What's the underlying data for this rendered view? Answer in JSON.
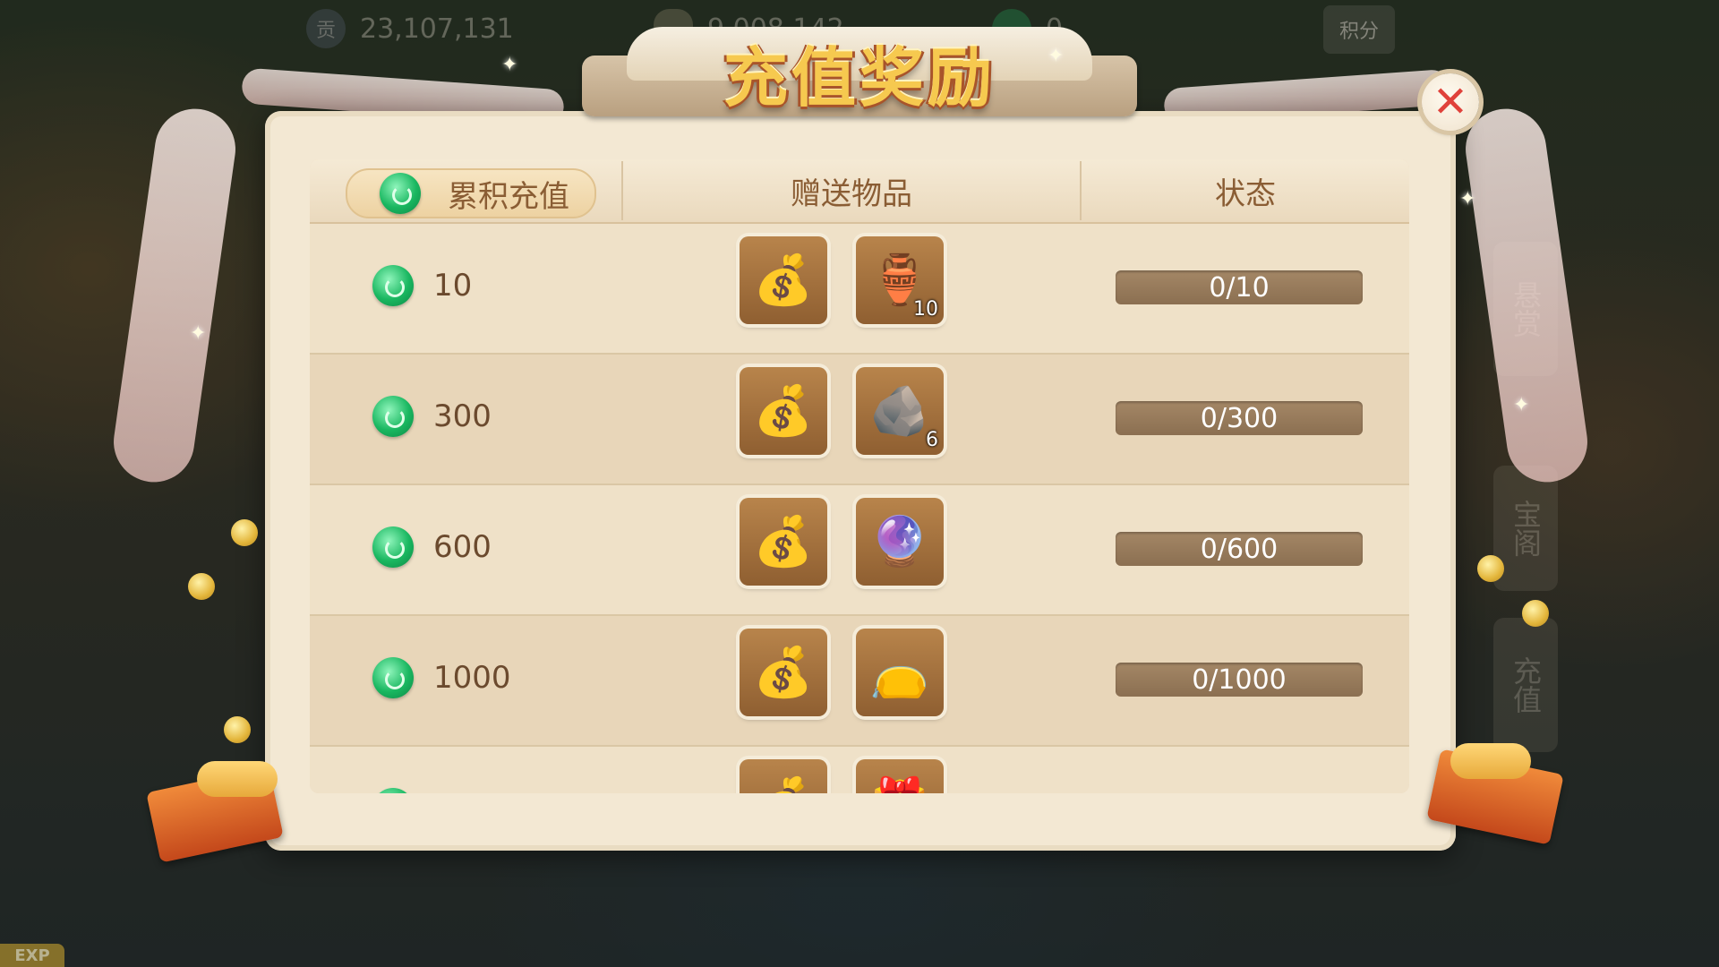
{
  "top_bar": {
    "contribution": {
      "icon": "contribution-icon",
      "glyph": "贡",
      "value": "23,107,131"
    },
    "silver": {
      "icon": "silver-ingot-icon",
      "value": "9,008,142"
    },
    "jade": {
      "icon": "jade-icon",
      "value": "0"
    },
    "score_button": "积分"
  },
  "exp_label": "EXP",
  "side_tabs": [
    "悬赏",
    "宝阁",
    "充值"
  ],
  "dialog": {
    "title": "充值奖励",
    "close_symbol": "✕",
    "headers": {
      "cumulative": "累积充值",
      "gifts": "赠送物品",
      "status": "状态"
    },
    "rows": [
      {
        "amount": "10",
        "items": [
          {
            "icon": "silver-money-bag-icon",
            "count": ""
          },
          {
            "icon": "herb-vase-icon",
            "count": "10"
          }
        ],
        "status": "0/10"
      },
      {
        "amount": "300",
        "items": [
          {
            "icon": "silver-money-bag-icon",
            "count": ""
          },
          {
            "icon": "black-ore-icon",
            "count": "6"
          }
        ],
        "status": "0/300"
      },
      {
        "amount": "600",
        "items": [
          {
            "icon": "silver-money-bag-icon",
            "count": ""
          },
          {
            "icon": "crystal-orb-icon",
            "count": ""
          }
        ],
        "status": "0/600"
      },
      {
        "amount": "1000",
        "items": [
          {
            "icon": "silver-money-bag-icon",
            "count": ""
          },
          {
            "icon": "gold-lucky-bag-icon",
            "count": ""
          }
        ],
        "status": "0/1000"
      }
    ]
  },
  "colors": {
    "panel_bg": "#f3e8d3",
    "header_text": "#8a5d34",
    "status_bar": "#9c7f5f",
    "close_x": "#e0423b",
    "title_gold": "#f6c94f",
    "jade_green": "#19b760"
  }
}
